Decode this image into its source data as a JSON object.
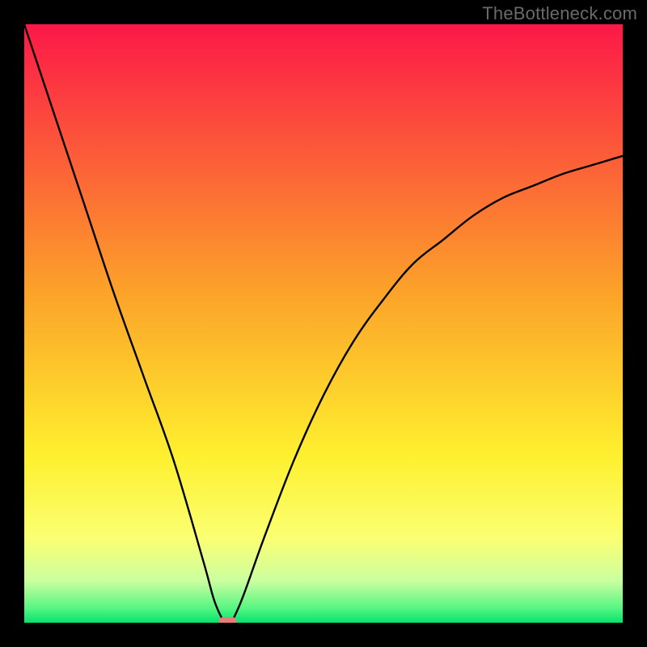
{
  "watermark": "TheBottleneck.com",
  "chart_data": {
    "type": "line",
    "title": "",
    "xlabel": "",
    "ylabel": "",
    "xlim": [
      0,
      100
    ],
    "ylim": [
      0,
      100
    ],
    "x": [
      0,
      5,
      10,
      15,
      20,
      25,
      30,
      32,
      34,
      36,
      40,
      45,
      50,
      55,
      60,
      65,
      70,
      75,
      80,
      85,
      90,
      95,
      100
    ],
    "values": [
      100,
      85,
      70,
      55,
      41,
      27,
      10,
      3,
      0,
      3,
      14,
      27,
      38,
      47,
      54,
      60,
      64,
      68,
      71,
      73,
      75,
      76.5,
      78
    ],
    "min_x": 34,
    "marker": {
      "x": 34,
      "y": 0,
      "color": "#eb7b76"
    },
    "background_gradient": {
      "stops": [
        {
          "offset": 0.0,
          "color": "#fc1848"
        },
        {
          "offset": 0.45,
          "color": "#fca329"
        },
        {
          "offset": 0.72,
          "color": "#fef02e"
        },
        {
          "offset": 0.86,
          "color": "#fbff73"
        },
        {
          "offset": 0.93,
          "color": "#cbffa0"
        },
        {
          "offset": 0.975,
          "color": "#59f683"
        },
        {
          "offset": 1.0,
          "color": "#04e36d"
        }
      ]
    }
  }
}
